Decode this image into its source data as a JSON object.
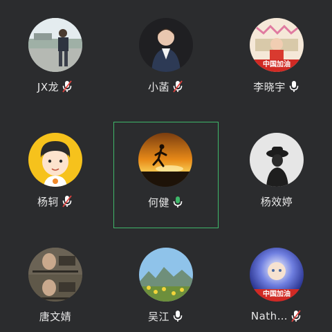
{
  "participants": [
    {
      "name": "JX龙",
      "mic": "muted",
      "avatar": "man-standing-outdoors-photo"
    },
    {
      "name": "小菡",
      "mic": "muted",
      "avatar": "woman-portrait-photo"
    },
    {
      "name": "李晓宇",
      "mic": "on",
      "avatar": "child-flag-photo",
      "banner": "中国加油"
    },
    {
      "name": "杨轲",
      "mic": "muted",
      "avatar": "cartoon-boy-avatar"
    },
    {
      "name": "何健",
      "mic": "on",
      "avatar": "runner-sunset-photo",
      "active": true
    },
    {
      "name": "杨效婷",
      "mic": "none",
      "avatar": "girl-hat-silhouette"
    },
    {
      "name": "唐文婧",
      "mic": "none",
      "avatar": "movie-still-photo"
    },
    {
      "name": "吴江",
      "mic": "on",
      "avatar": "mountain-flowers-landscape"
    },
    {
      "name": "Nath…",
      "mic": "muted",
      "avatar": "baby-flag-photo",
      "banner": "中国加油"
    }
  ],
  "colors": {
    "background": "#2b2c2e",
    "active_border": "#3fb86a",
    "mic_on": "#ffffff",
    "mic_muted_slash": "#e0433f"
  }
}
